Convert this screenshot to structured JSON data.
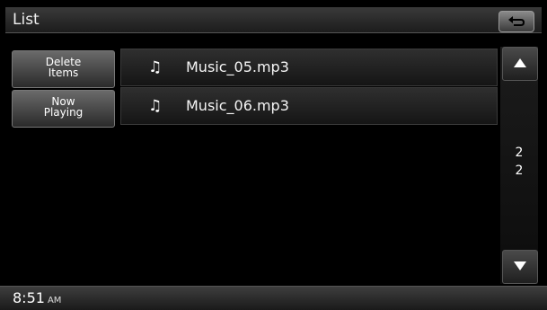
{
  "header": {
    "title": "List"
  },
  "side_buttons": [
    {
      "line1": "Delete",
      "line2": "Items"
    },
    {
      "line1": "Now",
      "line2": "Playing"
    }
  ],
  "tracks": [
    {
      "icon": "music-note-icon",
      "glyph": "♫",
      "name": "Music_05.mp3"
    },
    {
      "icon": "music-note-icon",
      "glyph": "♫",
      "name": "Music_06.mp3"
    }
  ],
  "pager": {
    "current": "2",
    "total": "2"
  },
  "status": {
    "time": "8:51",
    "ampm": "AM"
  }
}
